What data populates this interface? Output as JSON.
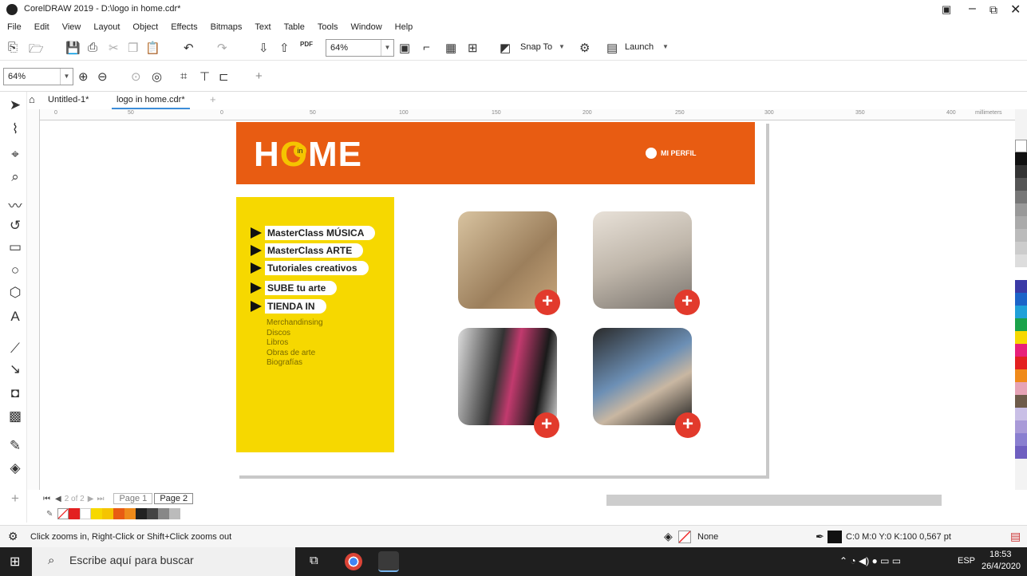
{
  "titlebar": {
    "title": "CorelDRAW 2019 - D:\\logo in home.cdr*"
  },
  "menu": [
    "File",
    "Edit",
    "View",
    "Layout",
    "Object",
    "Effects",
    "Bitmaps",
    "Text",
    "Table",
    "Tools",
    "Window",
    "Help"
  ],
  "toolbar": {
    "zoom_value": "64%",
    "snap_label": "Snap To",
    "launch_label": "Launch",
    "pdf_label": "PDF"
  },
  "property_bar": {
    "zoom_value": "64%"
  },
  "tabs": [
    "Untitled-1*",
    "logo in home.cdr*"
  ],
  "ruler": {
    "h_ticks": [
      "0",
      "50",
      "0",
      "50",
      "100",
      "150",
      "200",
      "250",
      "300",
      "350",
      "400"
    ],
    "unit": "millimeters"
  },
  "design": {
    "logo": "H",
    "logo_o": "O",
    "logo_me": "ME",
    "logo_badge": "in",
    "profile": "MI PERFIL",
    "menu_items": [
      "MasterClass MÚSICA",
      "MasterClass ARTE",
      "Tutoriales creativos",
      "SUBE tu arte",
      "TIENDA IN"
    ],
    "sub_items": [
      "Merchandinsing",
      "Discos",
      "Libros",
      "Obras de arte",
      "Biografías"
    ],
    "plus": "+",
    "colors": {
      "orange": "#e85c12",
      "yellow": "#f6d800",
      "plus_red": "#e23a2c"
    }
  },
  "page_nav": {
    "counter": "2 of 2",
    "pages": [
      "Page 1",
      "Page 2"
    ]
  },
  "status": {
    "hint": "Click zooms in, Right-Click or Shift+Click zooms out",
    "fill": "None",
    "outline": "C:0 M:0 Y:0 K:100  0,567 pt"
  },
  "taskbar": {
    "search_placeholder": "Escribe aquí para buscar",
    "lang": "ESP",
    "time": "18:53",
    "date": "26/4/2020"
  }
}
